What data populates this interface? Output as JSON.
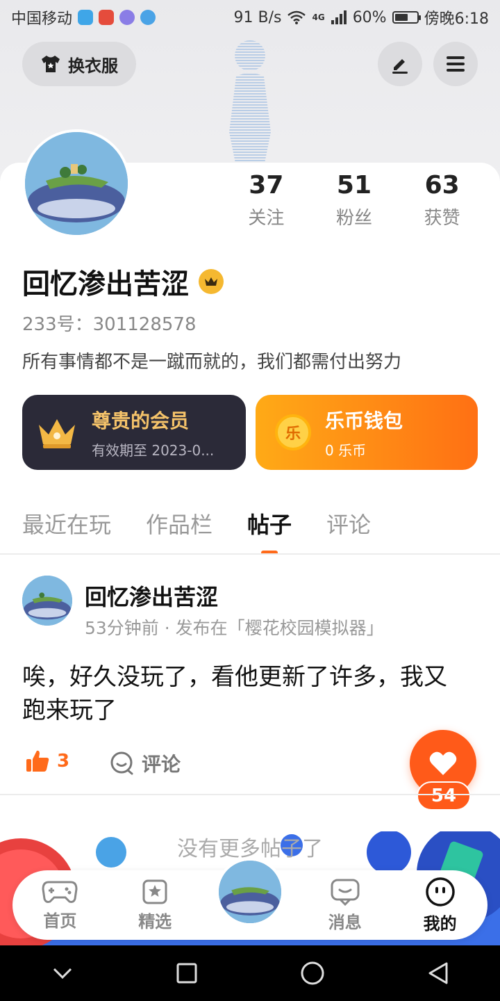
{
  "status_bar": {
    "carrier": "中国移动",
    "speed": "91 B/s",
    "network": "4G",
    "battery": "60%",
    "battery_level": 0.6,
    "time": "傍晚6:18"
  },
  "header": {
    "outfit_button": "换衣服"
  },
  "profile": {
    "stats": [
      {
        "value": "37",
        "label": "关注"
      },
      {
        "value": "51",
        "label": "粉丝"
      },
      {
        "value": "63",
        "label": "获赞"
      }
    ],
    "username": "回忆渗出苦涩",
    "uid": "233号：301128578",
    "bio": "所有事情都不是一蹴而就的，我们都需付出努力"
  },
  "cards": {
    "vip": {
      "title": "尊贵的会员",
      "subtitle": "有效期至 2023-0..."
    },
    "wallet": {
      "title": "乐币钱包",
      "subtitle": "0 乐币",
      "coin_label": "乐"
    }
  },
  "tabs": [
    {
      "label": "最近在玩"
    },
    {
      "label": "作品栏"
    },
    {
      "label": "帖子"
    },
    {
      "label": "评论"
    }
  ],
  "post": {
    "author": "回忆渗出苦涩",
    "meta": "53分钟前 · 发布在「樱花校园模拟器」",
    "body": "唉，好久没玩了，看他更新了许多，我又跑来玩了",
    "likes": "3",
    "comment_label": "评论"
  },
  "fab": {
    "count": "54"
  },
  "feed_end": "没有更多帖子了",
  "bottom_nav": [
    {
      "label": "首页"
    },
    {
      "label": "精选"
    },
    {
      "label": "消息"
    },
    {
      "label": "我的"
    }
  ],
  "colors": {
    "accent": "#ff6a1a",
    "vip_bg": "#2b2a38",
    "vip_gold": "#f5c36a"
  }
}
